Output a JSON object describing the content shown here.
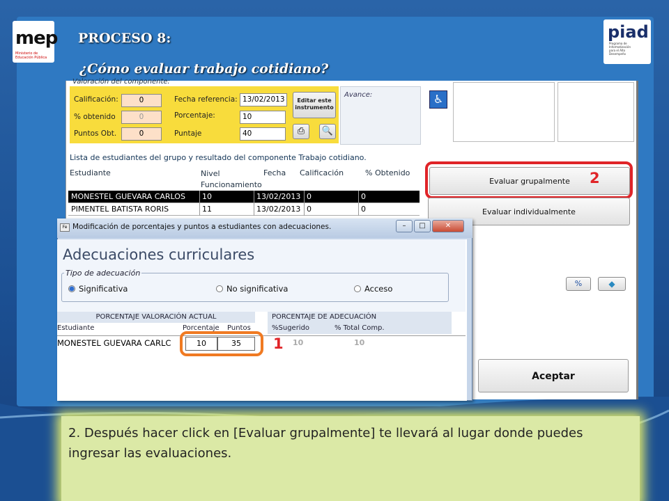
{
  "slide": {
    "title": "PROCESO 8:",
    "subtitle": "¿Cómo evaluar  trabajo cotidiano?",
    "logo_left": {
      "text": "mep",
      "sub": "Ministerio de Educación Pública"
    },
    "logo_right": {
      "text": "piad",
      "sub": "Programa de Informatización para el Alto Desempeño"
    }
  },
  "form": {
    "section_label": "Valoración del componente:",
    "calificacion_label": "Calificación:",
    "calificacion_value": "0",
    "obtenido_label": "% obtenido",
    "obtenido_value": "0",
    "puntos_label": "Puntos Obt.",
    "puntos_value": "0",
    "fecha_label": "Fecha referencia:",
    "fecha_value": "13/02/2013",
    "porcentaje_label": "Porcentaje:",
    "porcentaje_value": "10",
    "puntaje_label": "Puntaje",
    "puntaje_value": "40",
    "editar_label": "Editar este instrumento",
    "avance_label": "Avance:"
  },
  "list": {
    "caption": "Lista de estudiantes del grupo y resultado del componente Trabajo cotidiano.",
    "headers": [
      "Estudiante",
      "Nivel Funcionamiento",
      "Fecha",
      "Calificación",
      "% Obtenido"
    ],
    "rows": [
      [
        "MONESTEL GUEVARA CARLOS",
        "10",
        "13/02/2013",
        "0",
        "0"
      ],
      [
        "PIMENTEL BATISTA RORIS",
        "11",
        "13/02/2013",
        "0",
        "0"
      ]
    ]
  },
  "buttons": {
    "grupal": "Evaluar grupalmente",
    "individual": "Evaluar individualmente",
    "aceptar": "Aceptar"
  },
  "annotations": {
    "one": "1",
    "two": "2"
  },
  "dialog": {
    "title": "Modificación de porcentajes y puntos a estudiantes con adecuaciones.",
    "heading": "Adecuaciones curriculares",
    "tipo_label": "Tipo de adecuación",
    "radios": [
      "Significativa",
      "No significativa",
      "Acceso"
    ],
    "selected": "Significativa",
    "pct_actual_header": "PORCENTAJE VALORACIÓN ACTUAL",
    "pct_adec_header": "PORCENTAJE DE ADECUACIÓN",
    "col_estudiante": "Estudiante",
    "col_porcentaje": "Porcentaje",
    "col_puntos": "Puntos",
    "col_sugerido": "%Sugerido",
    "col_total": "% Total Comp.",
    "row": {
      "name": "MONESTEL GUEVARA CARLC",
      "porcentaje": "10",
      "puntos": "35",
      "sugerido": "10",
      "total": "10"
    }
  },
  "note": "2. Después hacer click en [Evaluar grupalmente] te llevará al lugar donde puedes ingresar las evaluaciones.",
  "colors": {
    "highlight_red": "#e02428",
    "highlight_orange": "#f07a22",
    "form_yellow": "#f8dc3c",
    "note_bg": "#dbe9a6"
  }
}
